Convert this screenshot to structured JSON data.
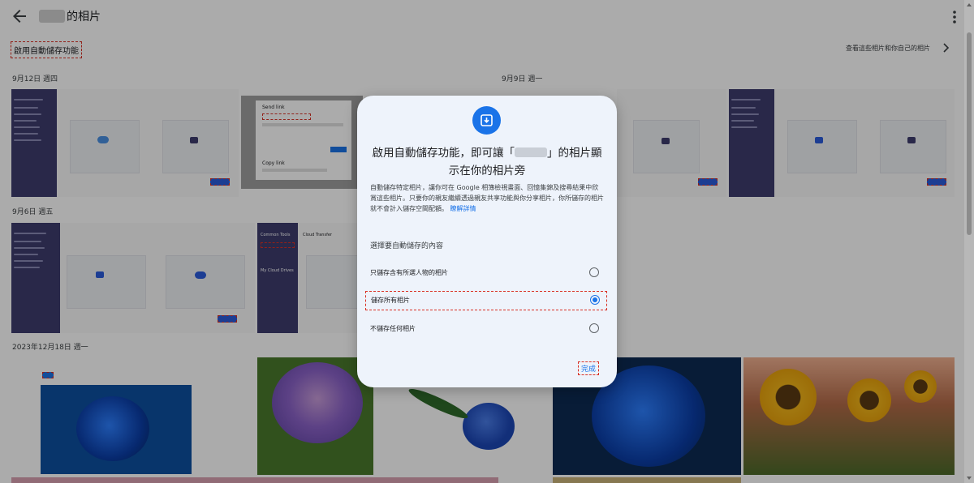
{
  "header": {
    "title": "的相片",
    "enable_button": "啟用自動儲存功能",
    "share_link": "查看這些相片和你自己的相片"
  },
  "sections": [
    {
      "date": "9月12日 週四"
    },
    {
      "date": "9月9日 週一"
    },
    {
      "date": "9月6日 週五"
    },
    {
      "date": "2023年12月18日 週一"
    }
  ],
  "thumb_texts": {
    "send_link": "Send link",
    "copy_link": "Copy link",
    "send": "Send",
    "copy": "Copy",
    "cloud_transfer": "Cloud Transfer",
    "common_tools": "Common Tools",
    "my_cloud_drives": "My Cloud Drives"
  },
  "dialog": {
    "title_part1": "啟用自動儲存功能，即可讓「",
    "title_part2": "」的相片顯示在你的相片旁",
    "description": "自動儲存特定相片，讓你可在 Google 相簿檢視畫面、回憶集錦及搜尋結果中欣賞這些相片。只要你的親友繼續透過親友共享功能與你分享相片，你所儲存的相片就不會計入儲存空間配額。",
    "learn_more": "瞭解詳情",
    "section_label": "選擇要自動儲存的內容",
    "options": [
      {
        "label": "只儲存含有所選人物的相片",
        "selected": false
      },
      {
        "label": "儲存所有相片",
        "selected": true
      },
      {
        "label": "不儲存任何相片",
        "selected": false
      }
    ],
    "done_label": "完成"
  },
  "colors": {
    "accent": "#1a73e8",
    "highlight": "#d93025",
    "dialog_bg": "#eef3fb",
    "overlay": "rgba(0,0,0,0.33)"
  }
}
